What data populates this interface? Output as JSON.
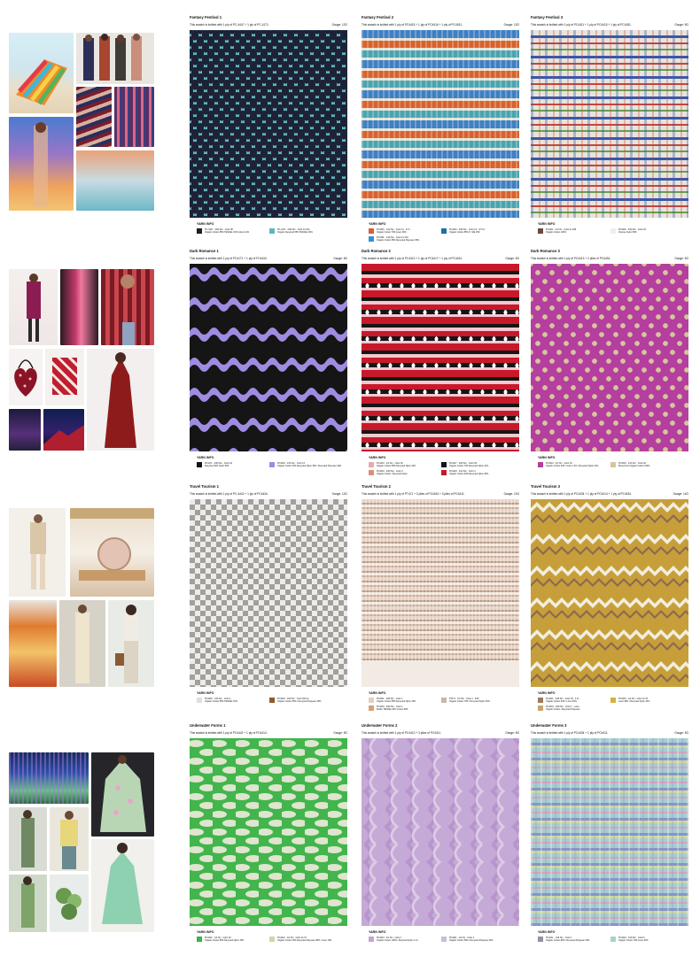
{
  "cards": [
    {
      "title": "Fantasy Festival 1",
      "sub": "This swatch is knitted with 1 ply of PC-4447 + 1 ply of PC-4171.",
      "gauge": "Gauge: 12G",
      "yarn_title": "YARN INFO",
      "yarns": [
        {
          "code": "PC-4447 · 2/60 Nm · Color 08",
          "desc": "Organic Cotton 85% TENCEL 15% Colour 14%",
          "color": "#1d1d24"
        },
        {
          "code": "PC-4171 · 2/60 Nm · Color Fx 034",
          "desc": "Organic Recycled 55% TENCEL 45%",
          "color": "#5fb6c2"
        }
      ]
    },
    {
      "title": "Fantasy Festival 2",
      "sub": "This swatch is knitted with 1 ply of PC4415 + 1 ply of PC4416 + 1 ply of PC4181.",
      "gauge": "Gauge: 12G",
      "yarn_title": "YARN INFO",
      "yarns": [
        {
          "code": "PC4415 · 1/12 Nm · Color 11 · 47.6",
          "desc": "Organic Cotton 70% Linen 30%",
          "color": "#d9612e"
        },
        {
          "code": "PC4416 · 2/60 Nm · Color 13 · 47.6 G",
          "desc": "Organic Cotton 85% O. Silk 15%",
          "color": "#1f6fa8"
        },
        {
          "code": "PC4181 · 1/16 Nm · Color Fx 034",
          "desc": "Organic Cotton 65% Recycled Polyester 35%",
          "color": "#3a8fd0"
        }
      ]
    },
    {
      "title": "Fantasy Festival 3",
      "sub": "This swatch is knitted with 1 ply of PC4411 + 1 ply of PC4415 + 1 ply of PC4181.",
      "gauge": "Gauge: 5G",
      "yarn_title": "YARN INFO",
      "yarns": [
        {
          "code": "PC4411 · 2/1 Nm · Color Fx 046",
          "desc": "Organic Cotton 100%",
          "color": "#6b4b3e"
        },
        {
          "code": "PC4415 · 2/60 Nm · Color 03",
          "desc": "Viscose Nylon 50%",
          "color": "#eeeeee"
        }
      ]
    },
    {
      "title": "Dark Romance 1",
      "sub": "This swatch is knitted with 1 ply of PC4171 + 1 ply of PC4434.",
      "gauge": "Gauge: 5G",
      "yarn_title": "YARN INFO",
      "yarns": [
        {
          "code": "PC4171 · 2/60 Nm · Color 04",
          "desc": "Recycled 50% Nylon 50%",
          "color": "#151515"
        },
        {
          "code": "PC4434 · 1/16 Nm · Color 13",
          "desc": "Organic Cotton 46% Recycled Nylon 35% / Recycled Polyester 19%",
          "color": "#9f8be0"
        }
      ]
    },
    {
      "title": "Dark Romance 2",
      "sub": "This swatch is knitted with 1 ply of PC4413 + 1 ply of PC4417 + 1 ply of PC4424.",
      "gauge": "Gauge: 5G",
      "yarn_title": "YARN INFO",
      "yarns": [
        {
          "code": "PC4413 · 2/1 Nm · Color 06",
          "desc": "Organic Cotton 58% Recycled Nylon 42%",
          "color": "#e8aab5"
        },
        {
          "code": "PC4417 · 2/60 Nm · Color 45",
          "desc": "Organic Cotton 79% Recycled Nylon 21%",
          "color": "#151515"
        },
        {
          "code": "PC4424 · 1/14 Nm · Color 4",
          "desc": "Organic Cotton 64% Recycled Nylon 36%",
          "color": "#c8192b"
        },
        {
          "code": "PC4424 · 2/60 Nm · Color 4",
          "desc": "Organic Cotton / Recycled Nylon",
          "color": "#d98f7b"
        }
      ]
    },
    {
      "title": "Dark Romance 3",
      "sub": "This swatch is knitted with 1 ply of PC4413 + 2 plies of PC4434.",
      "gauge": "Gauge: 5G",
      "yarn_title": "YARN INFO",
      "yarns": [
        {
          "code": "PC4413 · 2/1 Nm · Color 03",
          "desc": "Organic Cotton 64% / Color 1 3% / Recycled Nylon 21%",
          "color": "#b43f9e"
        },
        {
          "code": "PC4434 · 1/16 Nm · Color 02",
          "desc": "Mercerized Organic Cotton 100%",
          "color": "#d6c49e"
        }
      ]
    },
    {
      "title": "Travel Tourism 1",
      "sub": "This swatch is knitted with 1 ply of PC-4442 + 1 ply of PC4434.",
      "gauge": "Gauge: 12G",
      "yarn_title": "YARN INFO",
      "yarns": [
        {
          "code": "PC4464 · 1/16 Nm · Color 1",
          "desc": "Organic Cotton 85% TENCEL 15%",
          "color": "#dedede"
        },
        {
          "code": "PC4434 · 1/60 Nm · Color 09 Fx1",
          "desc": "Organic Cotton 55% / Recycled Polyester 45%",
          "color": "#8f5b2e"
        }
      ]
    },
    {
      "title": "Travel Tourism 2",
      "sub": "This swatch is knitted with 1 ply of PT471 + 3 plies of PC4434 + 3 plies of PC4411.",
      "gauge": "Gauge: 10G",
      "yarn_title": "YARN INFO",
      "yarns": [
        {
          "code": "PC4411 · 2/60 Nm · Color 1",
          "desc": "Organic Cotton 85% Recycled Nylon 15%",
          "color": "#e4cfc2"
        },
        {
          "code": "PT471 · 1/2 Nm · Color 1 · 3/40",
          "desc": "Organic Cotton 70% / Recycled Nylon 30%",
          "color": "#c9b7aa"
        },
        {
          "code": "PC4434 · 2/60 Nm · Color 1",
          "desc": "Muslin TENCEL 50% Cotton 50%",
          "color": "#d9a07a"
        }
      ]
    },
    {
      "title": "Travel Tourism 3",
      "sub": "This swatch is knitted with 1 ply of PC4434 + 1 ply of PC4414 + 1 ply of PC4434.",
      "gauge": "Gauge: 14G",
      "yarn_title": "YARN INFO",
      "yarns": [
        {
          "code": "PC4411 · 2/30 Nm · Color 02 · 4 Fx",
          "desc": "Organic Cotton 64% / Linen 36%",
          "color": "#9c7a5e"
        },
        {
          "code": "PC4434 · 1/2 Nm · Color Fx 03",
          "desc": "Linen 56% / Recycled Nylon 44%",
          "color": "#d9b13a"
        },
        {
          "code": "PC4434 · 1/60 Nm · Color 1 · Lurex",
          "desc": "Organic Cotton / Recycled Polyester",
          "color": "#c4a86a"
        }
      ]
    },
    {
      "title": "Underwater Forms 1",
      "sub": "This swatch is knitted with 1 ply of PC4442 + 1 ply of PC4414.",
      "gauge": "Gauge: 5G",
      "yarn_title": "YARN INFO",
      "yarns": [
        {
          "code": "PC4442 · 1/2 Nm · Color 02",
          "desc": "Organic Cotton 85% Recycled Nylon 15%",
          "color": "#3bb44a"
        },
        {
          "code": "PC4414 · 1/2 Nm · Color Fx 07",
          "desc": "Organic Cotton 46% Recycled Polyester 38% / Linen 16%",
          "color": "#cfd8a8"
        }
      ]
    },
    {
      "title": "Underwater Forms 2",
      "sub": "This swatch is knitted with 1 ply of PC4413 + 3 plies of PC4411.",
      "gauge": "Gauge: 5G",
      "yarn_title": "YARN INFO",
      "yarns": [
        {
          "code": "PC4413 · 2/1 Nm · Color 1",
          "desc": "Organic Cotton 100% / Recycled Nylon 1 Fx",
          "color": "#c6a6d6"
        },
        {
          "code": "PC4411 · 1/2 Nm · Color 1",
          "desc": "Organic Cotton 56% / Recycled Polyester 44%",
          "color": "#c7bfdd"
        }
      ]
    },
    {
      "title": "Underwater Forms 3",
      "sub": "This swatch is knitted with 1 ply of PC4434 + 1 ply of PC4411.",
      "gauge": "Gauge: 5G",
      "yarn_title": "YARN INFO",
      "yarns": [
        {
          "code": "PC4411 · 1/16 Nm · Color 1",
          "desc": "Organic Cotton 85% / Recycled Polyester 15%",
          "color": "#9a8fa6"
        },
        {
          "code": "PC4434 · 1/16 Nm · Color 6",
          "desc": "Organic Cotton 70% Linen 30%",
          "color": "#a8d4c8"
        }
      ]
    }
  ],
  "colors": {
    "ff1": [
      "#5fb6c2",
      "#1d2236"
    ],
    "ff2": [
      "#3f7fc4",
      "#d9612e",
      "#e6e3d4",
      "#4aa4b0"
    ],
    "ff3": [
      "#e8e4dc",
      "#3b57a6",
      "#c4453a",
      "#66a04d"
    ],
    "dr1": [
      "#151515",
      "#9f8be0"
    ],
    "dr2": [
      "#c8192b",
      "#151515",
      "#f1c9cf",
      "#ffffff"
    ],
    "dr3": [
      "#b43f9e",
      "#d6c49e"
    ],
    "tt1": [
      "#ecebe7",
      "#9a9894"
    ],
    "tt2": [
      "#e6d1c3",
      "#b59886"
    ],
    "tt3": [
      "#c79f3a",
      "#8b6a4e",
      "#f0eedf"
    ],
    "uw1": [
      "#42b54c",
      "#dfe5cf"
    ],
    "uw2": [
      "#c5a9d6",
      "#b795cc"
    ],
    "uw3": [
      "#a7cdd0",
      "#8595c9",
      "#d9a2b8",
      "#cfd79c"
    ]
  }
}
